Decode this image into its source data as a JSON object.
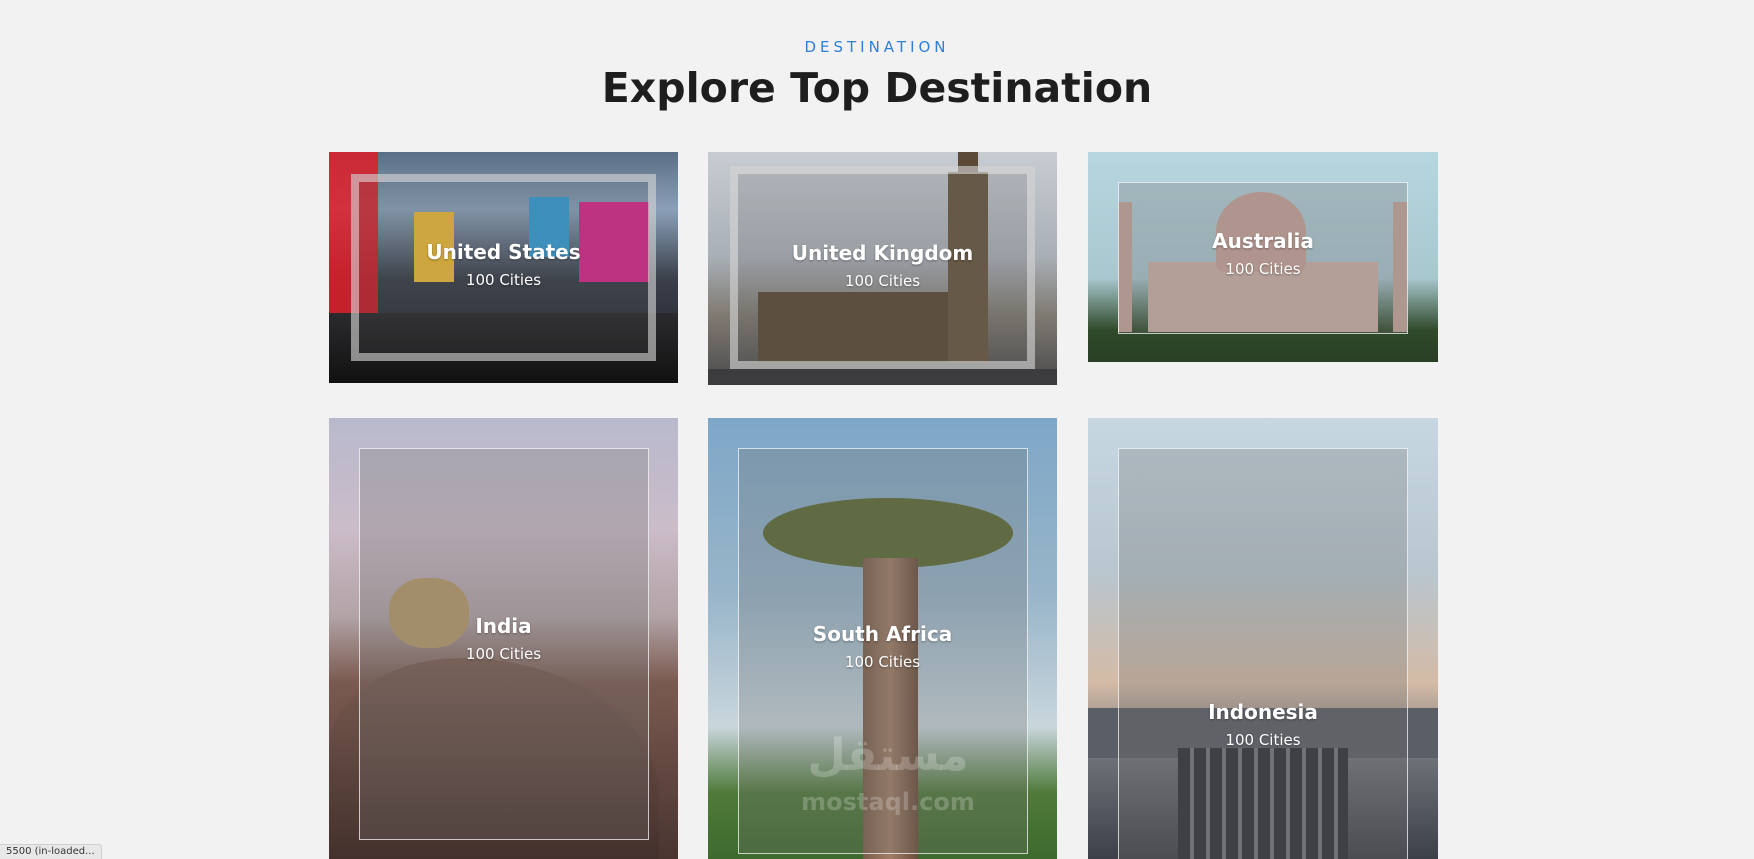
{
  "header": {
    "eyebrow": "DESTINATION",
    "title": "Explore Top Destination"
  },
  "destinations": [
    {
      "name": "United States",
      "cities": "100 Cities"
    },
    {
      "name": "United Kingdom",
      "cities": "100 Cities"
    },
    {
      "name": "Australia",
      "cities": "100 Cities"
    },
    {
      "name": "India",
      "cities": "100 Cities"
    },
    {
      "name": "South Africa",
      "cities": "100 Cities"
    },
    {
      "name": "Indonesia",
      "cities": "100 Cities"
    }
  ],
  "watermark": {
    "arabic": "مستقل",
    "latin": "mostaql.com"
  },
  "status_bar": {
    "text": "5500 (in-loaded..."
  },
  "colors": {
    "background": "#f2f2f2",
    "eyebrow": "#2f7fd8",
    "title": "#1e1e1e"
  }
}
